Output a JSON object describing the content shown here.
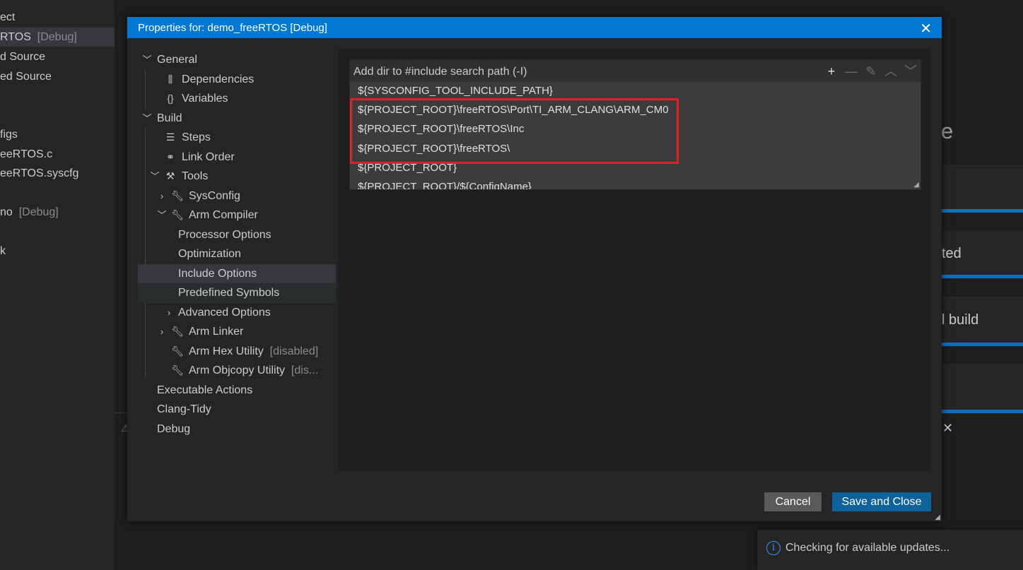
{
  "background": {
    "sidebar_items": [
      {
        "text": "ect",
        "suffix": ""
      },
      {
        "text": "RTOS",
        "suffix": "[Debug]"
      },
      {
        "text": "d Source",
        "suffix": ""
      },
      {
        "text": "ed Source",
        "suffix": ""
      },
      {
        "text": "figs",
        "suffix": ""
      },
      {
        "text": "eeRTOS.c",
        "suffix": ""
      },
      {
        "text": "eeRTOS.syscfg",
        "suffix": ""
      },
      {
        "text": "no",
        "suffix": "[Debug]"
      },
      {
        "text": "k",
        "suffix": ""
      }
    ],
    "right_letter": "e",
    "right_cards": [
      "",
      "ted",
      "l build",
      ""
    ],
    "toast_message": "Checking for available updates..."
  },
  "dialog": {
    "title": "Properties for: demo_freeRTOS [Debug]",
    "close_glyph": "✕",
    "tree": {
      "general": "General",
      "dependencies": "Dependencies",
      "variables": "Variables",
      "build": "Build",
      "steps": "Steps",
      "link_order": "Link Order",
      "tools": "Tools",
      "sysconfig": "SysConfig",
      "arm_compiler": "Arm Compiler",
      "processor_options": "Processor Options",
      "optimization": "Optimization",
      "include_options": "Include Options",
      "predefined_symbols": "Predefined Symbols",
      "advanced_options": "Advanced Options",
      "arm_linker": "Arm Linker",
      "arm_hex_utility": "Arm Hex Utility",
      "arm_hex_utility_state": "[disabled]",
      "arm_objcopy_utility": "Arm Objcopy Utility",
      "arm_objcopy_utility_state": "[dis...",
      "executable_actions": "Executable Actions",
      "clang_tidy": "Clang-Tidy",
      "debug": "Debug"
    },
    "include_list": {
      "header": "Add dir to #include search path (-I)",
      "items": [
        "${SYSCONFIG_TOOL_INCLUDE_PATH}",
        "${PROJECT_ROOT}\\freeRTOS\\Port\\TI_ARM_CLANG\\ARM_CM0",
        "${PROJECT_ROOT}\\freeRTOS\\Inc",
        "${PROJECT_ROOT}\\freeRTOS\\",
        "${PROJECT_ROOT}",
        "${PROJECT_ROOT}/${ConfigName}"
      ],
      "highlight_color": "#e0212a"
    },
    "buttons": {
      "cancel": "Cancel",
      "save_close": "Save and Close"
    }
  },
  "colors": {
    "title_bar": "#0078d4",
    "primary_button": "#0e639c",
    "secondary_button": "#5a5a5a",
    "selected_row": "#37373d"
  }
}
